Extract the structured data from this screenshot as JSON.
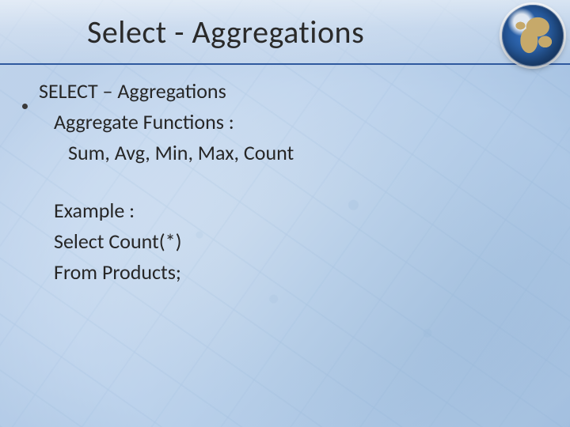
{
  "title": "Select - Aggregations",
  "globe_icon": "globe-icon",
  "body": {
    "bullet": "SELECT – Aggregations",
    "line_functions_label": "Aggregate Functions :",
    "line_functions_list": "Sum, Avg, Min, Max, Count",
    "example_label": "Example :",
    "example_line1": "Select Count(*)",
    "example_line2": "From Products;"
  }
}
